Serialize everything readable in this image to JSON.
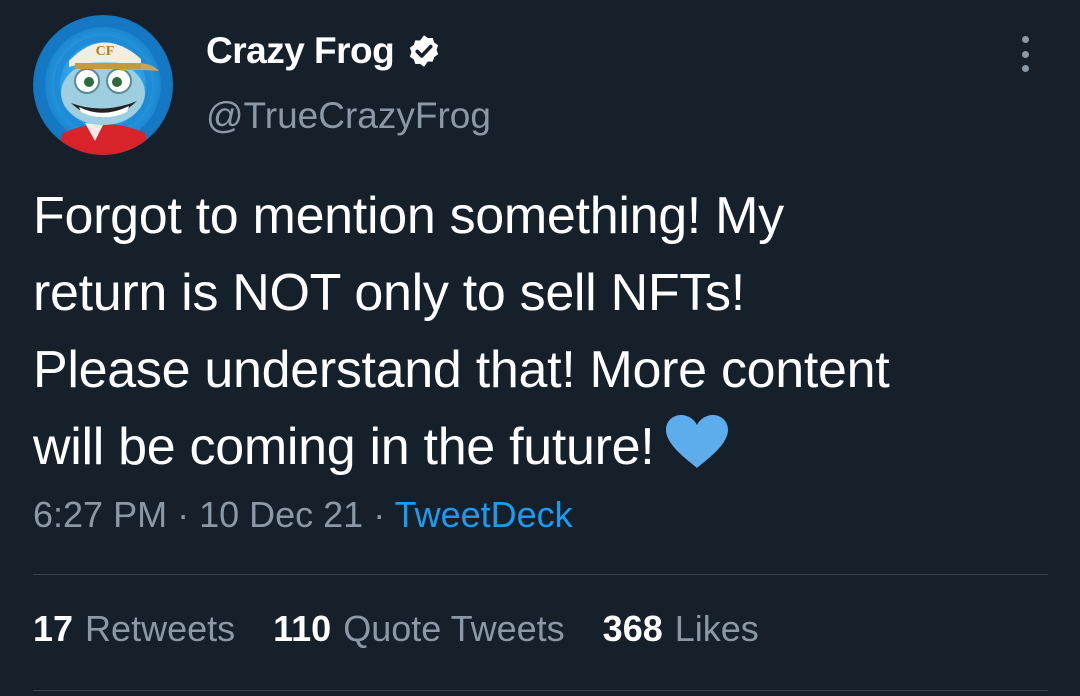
{
  "author": {
    "display_name": "Crazy Frog",
    "handle": "@TrueCrazyFrog",
    "verified": true,
    "cap_text": "CF"
  },
  "tweet": {
    "text": "Forgot to mention something! My\nreturn is NOT only to sell NFTs!\nPlease understand that! More content\nwill be coming in the future!",
    "emoji": "blue-heart",
    "time": "6:27 PM",
    "date": "10 Dec 21",
    "source": "TweetDeck"
  },
  "stats": {
    "retweets_count": "17",
    "retweets_label": "Retweets",
    "quotes_count": "110",
    "quotes_label": "Quote Tweets",
    "likes_count": "368",
    "likes_label": "Likes"
  },
  "colors": {
    "background": "#15202b",
    "text": "#ffffff",
    "muted": "#8b98a5",
    "link": "#1d9bf0",
    "heart": "#5dadec"
  }
}
